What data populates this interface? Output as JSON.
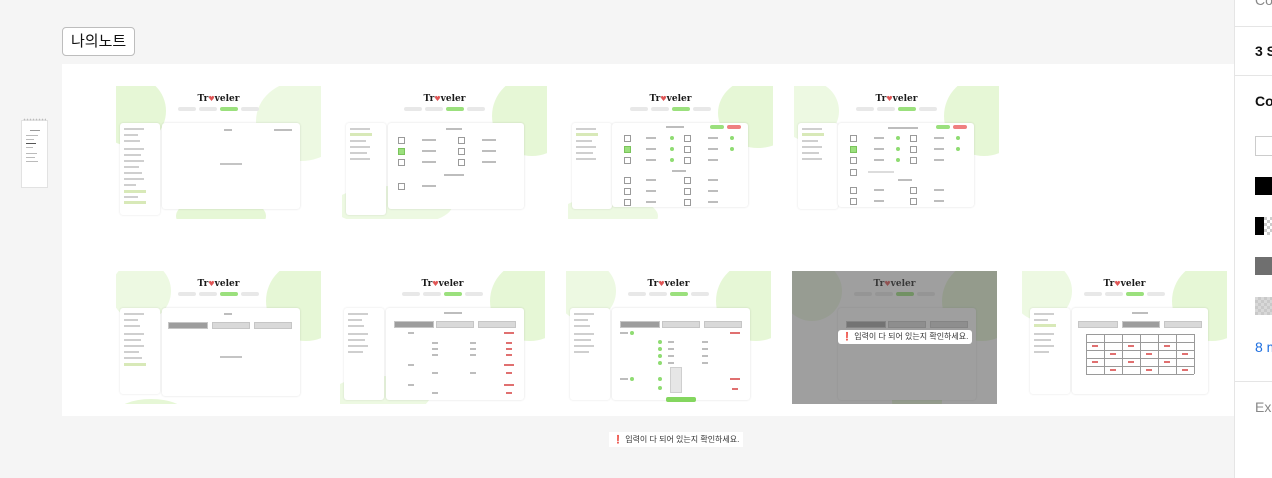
{
  "frame": {
    "label": "나의노트"
  },
  "toast": {
    "icon": "exclamation-icon",
    "message": "입력이 다 되어 있는지 확인하세요."
  },
  "modal": {
    "message": "입력이 다 되어 있는지 확인하세요."
  },
  "screens": {
    "logo_prefix": "Tr",
    "logo_suffix": "veler"
  },
  "right_panel": {
    "rows": [
      {
        "text": "Co"
      },
      {
        "text": "3 S"
      },
      {
        "text": "Co"
      },
      {
        "text": "8 m"
      },
      {
        "text": "Exp"
      }
    ],
    "colors": {
      "black": "#000000",
      "gray": "#6f6f6f",
      "link": "#1e6fe0"
    }
  },
  "theme": {
    "accent": "#9be07d",
    "alert": "#e23a3a"
  }
}
